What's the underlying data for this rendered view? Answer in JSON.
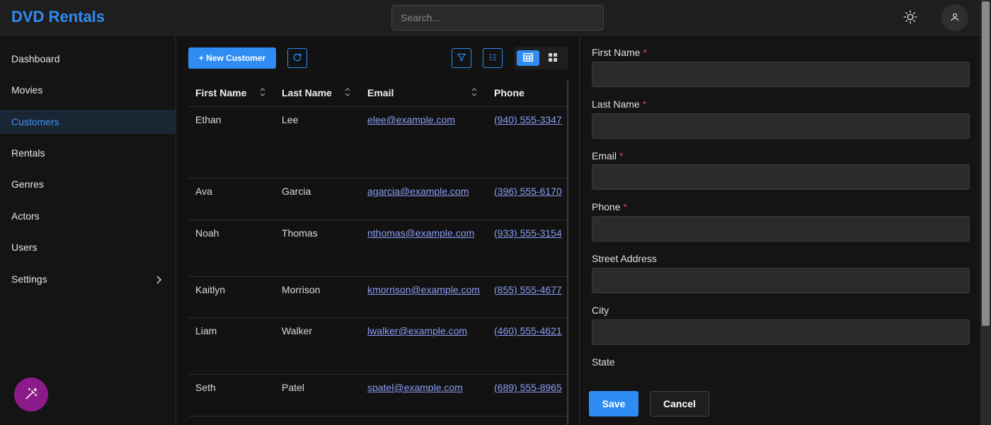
{
  "app": {
    "title": "DVD Rentals"
  },
  "search": {
    "placeholder": "Search..."
  },
  "sidebar": {
    "items": [
      {
        "label": "Dashboard"
      },
      {
        "label": "Movies"
      },
      {
        "label": "Customers",
        "active": true
      },
      {
        "label": "Rentals"
      },
      {
        "label": "Genres"
      },
      {
        "label": "Actors"
      },
      {
        "label": "Users"
      },
      {
        "label": "Settings",
        "has_submenu": true
      }
    ]
  },
  "toolbar": {
    "new_label": "+ New Customer"
  },
  "table": {
    "columns": [
      {
        "label": "First Name"
      },
      {
        "label": "Last Name"
      },
      {
        "label": "Email"
      },
      {
        "label": "Phone"
      }
    ],
    "rows": [
      {
        "first": "Ethan",
        "last": "Lee",
        "email": "elee@example.com",
        "phone": "(940) 555-3347"
      },
      {
        "first": "Ava",
        "last": "Garcia",
        "email": "agarcia@example.com",
        "phone": "(396) 555-6170"
      },
      {
        "first": "Noah",
        "last": "Thomas",
        "email": "nthomas@example.com",
        "phone": "(933) 555-3154"
      },
      {
        "first": "Kaitlyn",
        "last": "Morrison",
        "email": "kmorrison@example.com",
        "phone": "(855) 555-4677"
      },
      {
        "first": "Liam",
        "last": "Walker",
        "email": "lwalker@example.com",
        "phone": "(460) 555-4621"
      },
      {
        "first": "Seth",
        "last": "Patel",
        "email": "spatel@example.com",
        "phone": "(689) 555-8965"
      }
    ]
  },
  "form": {
    "fields": [
      {
        "label": "First Name",
        "required": "*"
      },
      {
        "label": "Last Name",
        "required": "*"
      },
      {
        "label": "Email",
        "required": "*"
      },
      {
        "label": "Phone",
        "required": "*"
      },
      {
        "label": "Street Address"
      },
      {
        "label": "City"
      },
      {
        "label": "State"
      }
    ],
    "save_label": "Save",
    "cancel_label": "Cancel"
  },
  "colors": {
    "accent": "#2f8cf3",
    "brand": "#2f8cf3",
    "link": "#8a9cf5",
    "required": "#e54848",
    "magic_button": "#8b1a8b"
  }
}
